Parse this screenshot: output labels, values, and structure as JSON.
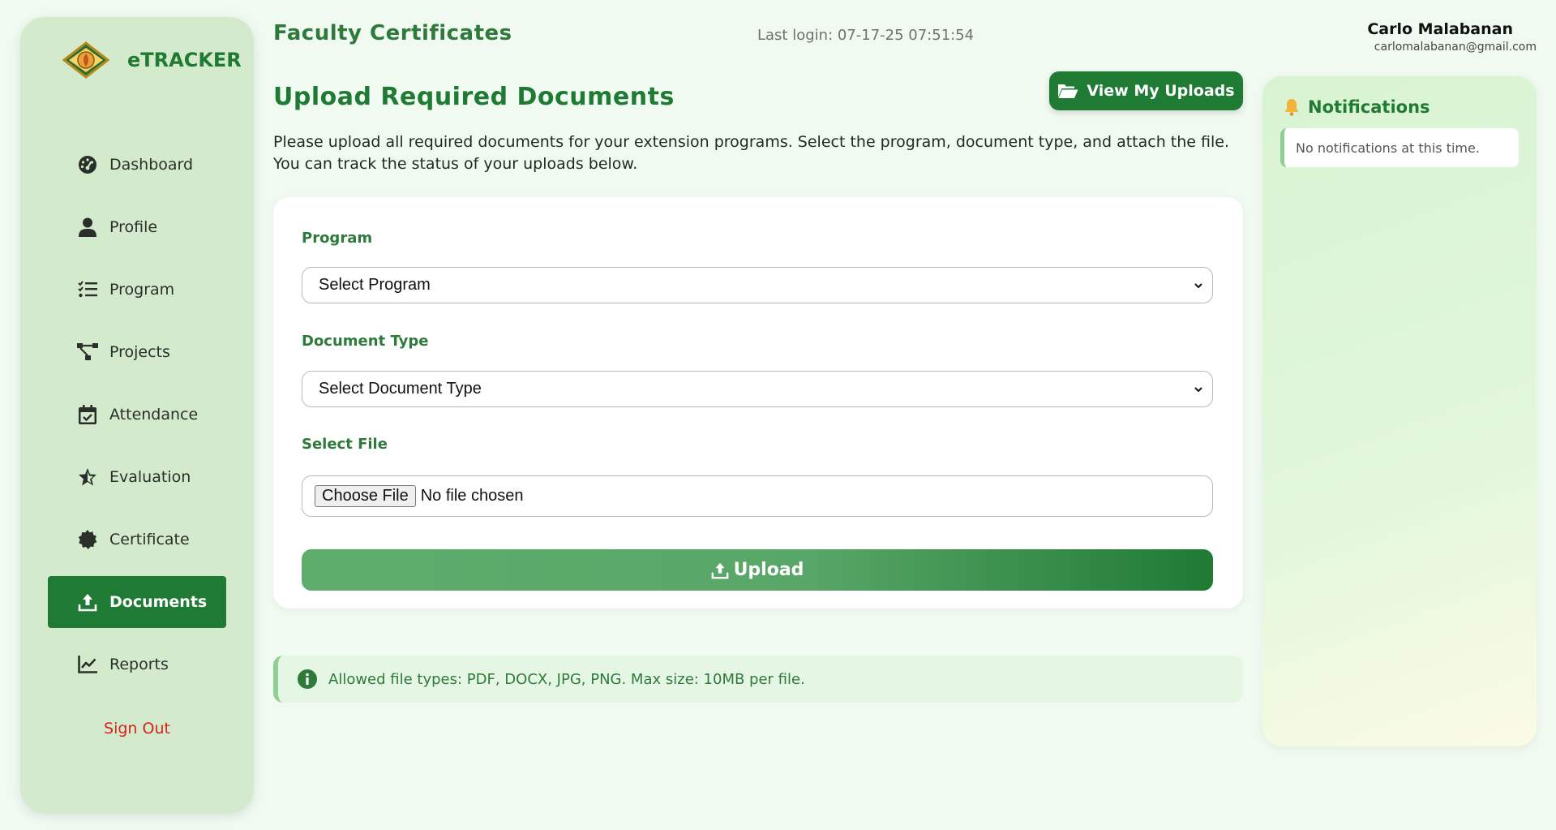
{
  "app": {
    "name": "eTRACKER"
  },
  "header": {
    "title": "Faculty Certificates",
    "last_login": "Last login: 07-17-25 07:51:54",
    "user_name": "Carlo Malabanan",
    "user_email": "carlomalabanan@gmail.com"
  },
  "sidebar": {
    "items": [
      {
        "label": "Dashboard",
        "icon": "gauge-icon"
      },
      {
        "label": "Profile",
        "icon": "user-icon"
      },
      {
        "label": "Program",
        "icon": "list-check-icon"
      },
      {
        "label": "Projects",
        "icon": "diagram-icon"
      },
      {
        "label": "Attendance",
        "icon": "calendar-check-icon"
      },
      {
        "label": "Evaluation",
        "icon": "star-icon"
      },
      {
        "label": "Certificate",
        "icon": "certificate-icon"
      },
      {
        "label": "Documents",
        "icon": "upload-icon",
        "active": true
      },
      {
        "label": "Reports",
        "icon": "chart-line-icon"
      }
    ],
    "sign_out": "Sign Out"
  },
  "main": {
    "section_title": "Upload Required Documents",
    "view_uploads_label": "View My Uploads",
    "description": "Please upload all required documents for your extension programs. Select the program, document type, and attach the file. You can track the status of your uploads below.",
    "form": {
      "program_label": "Program",
      "program_selected": "Select Program",
      "doc_type_label": "Document Type",
      "doc_type_selected": "Select Document Type",
      "file_label": "Select File",
      "choose_file_label": "Choose File",
      "file_status": "No file chosen",
      "upload_label": "Upload"
    },
    "info": "Allowed file types: PDF, DOCX, JPG, PNG. Max size: 10MB per file."
  },
  "notifications": {
    "title": "Notifications",
    "empty_text": "No notifications at this time."
  },
  "colors": {
    "primary": "#1f7a34",
    "sidebar_bg": "#d3ebcc",
    "page_bg": "#f1faf1",
    "sign_out": "#d6231b"
  }
}
